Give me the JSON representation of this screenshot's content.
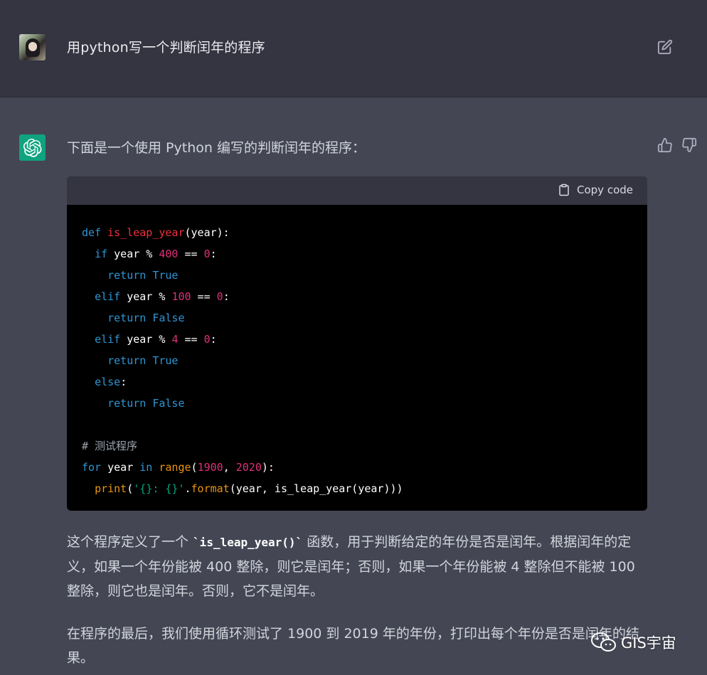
{
  "user": {
    "message": "用python写一个判断闰年的程序",
    "avatar_icon": "user-avatar",
    "edit_icon": "edit-icon"
  },
  "assistant": {
    "intro": "下面是一个使用 Python 编写的判断闰年的程序：",
    "avatar_icon": "openai-logo-icon",
    "accent_color": "#10a37f",
    "code_block": {
      "copy_label": "Copy code",
      "language": "python",
      "lines": [
        "def is_leap_year(year):",
        "  if year % 400 == 0:",
        "    return True",
        "  elif year % 100 == 0:",
        "    return False",
        "  elif year % 4 == 0:",
        "    return True",
        "  else:",
        "    return False",
        "",
        "# 测试程序",
        "for year in range(1900, 2020):",
        "  print('{}: {}'.format(year, is_leap_year(year)))"
      ]
    },
    "para1_a": "这个程序定义了一个 ",
    "para1_code": "`is_leap_year()`",
    "para1_b": " 函数，用于判断给定的年份是否是闰年。根据闰年的定义，如果一个年份能被 400 整除，则它是闰年；否则，如果一个年份能被 4 整除但不能被 100 整除，则它也是闰年。否则，它不是闰年。",
    "para2": "在程序的最后，我们使用循环测试了 1900 到 2019 年的年份，打印出每个年份是否是闰年的结果。"
  },
  "watermark": {
    "text": "GIS宇宙",
    "icon": "wechat-icon"
  }
}
